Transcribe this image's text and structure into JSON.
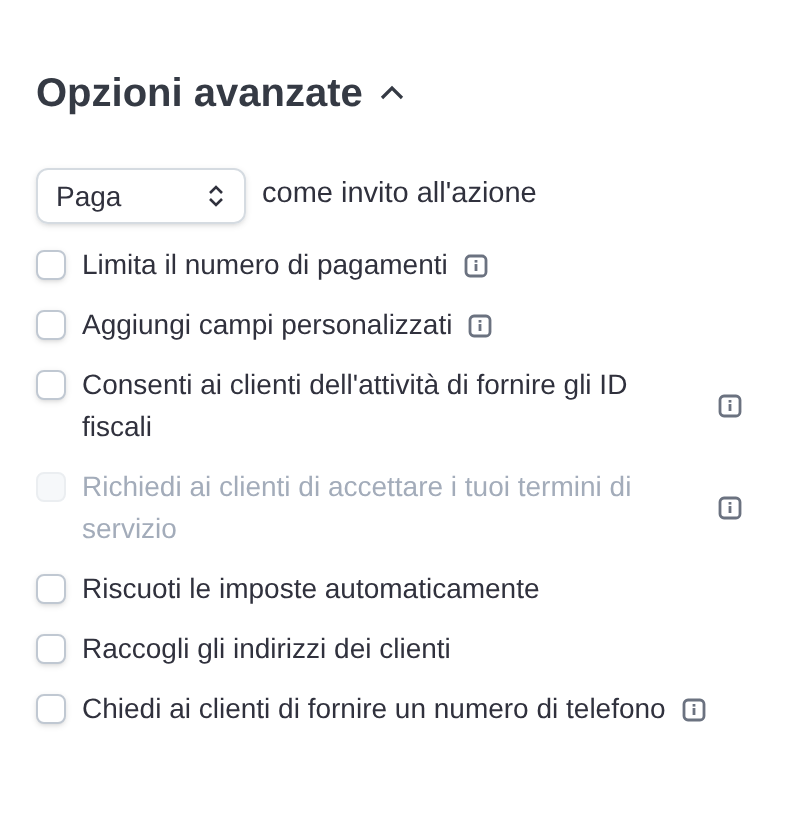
{
  "section": {
    "title": "Opzioni avanzate",
    "expanded": true
  },
  "cta": {
    "value": "Paga",
    "suffix": "come invito all'azione"
  },
  "options": [
    {
      "label": "Limita il numero di pagamenti",
      "checked": false,
      "disabled": false,
      "info": true
    },
    {
      "label": "Aggiungi campi personalizzati",
      "checked": false,
      "disabled": false,
      "info": true
    },
    {
      "label": "Consenti ai clienti dell'attività di fornire gli ID fiscali",
      "checked": false,
      "disabled": false,
      "info": true
    },
    {
      "label": "Richiedi ai clienti di accettare i tuoi termini di servizio",
      "checked": false,
      "disabled": true,
      "info": true
    },
    {
      "label": "Riscuoti le imposte automaticamente",
      "checked": false,
      "disabled": false,
      "info": false
    },
    {
      "label": "Raccogli gli indirizzi dei clienti",
      "checked": false,
      "disabled": false,
      "info": false
    },
    {
      "label": "Chiedi ai clienti di fornire un numero di telefono",
      "checked": false,
      "disabled": false,
      "info": true
    }
  ]
}
